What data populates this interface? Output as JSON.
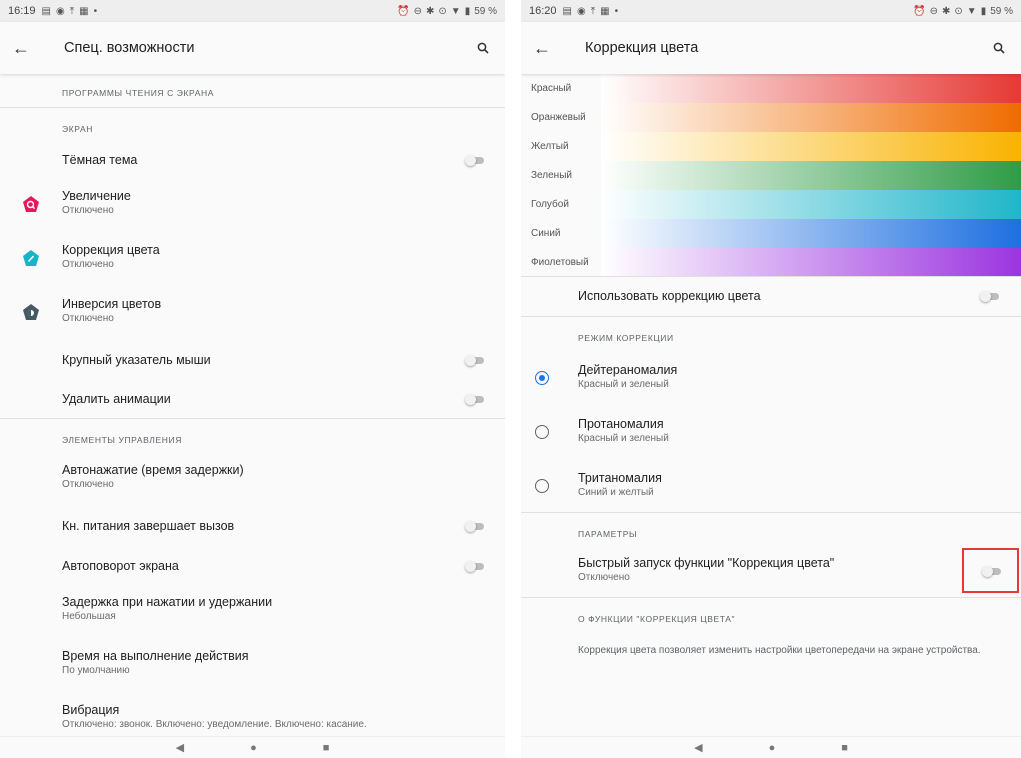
{
  "left": {
    "status": {
      "time": "16:19",
      "battery": "59 %"
    },
    "toolbar": {
      "title": "Спец. возможности"
    },
    "sections": {
      "screen_readers": "ПРОГРАММЫ ЧТЕНИЯ С ЭКРАНА",
      "screen": "ЭКРАН",
      "controls": "ЭЛЕМЕНТЫ УПРАВЛЕНИЯ"
    },
    "items": {
      "dark_theme": {
        "title": "Тёмная тема"
      },
      "magnification": {
        "title": "Увеличение",
        "sub": "Отключено"
      },
      "color_correction": {
        "title": "Коррекция цвета",
        "sub": "Отключено"
      },
      "color_inversion": {
        "title": "Инверсия цветов",
        "sub": "Отключено"
      },
      "large_pointer": {
        "title": "Крупный указатель мыши"
      },
      "remove_animations": {
        "title": "Удалить анимации"
      },
      "autoclick": {
        "title": "Автонажатие (время задержки)",
        "sub": "Отключено"
      },
      "power_ends_call": {
        "title": "Кн. питания завершает вызов"
      },
      "autorotate": {
        "title": "Автоповорот экрана"
      },
      "touch_hold_delay": {
        "title": "Задержка при нажатии и удержании",
        "sub": "Небольшая"
      },
      "action_time": {
        "title": "Время на выполнение действия",
        "sub": "По умолчанию"
      },
      "vibration": {
        "title": "Вибрация",
        "sub": "Отключено: звонок. Включено: уведомление. Включено: касание."
      }
    }
  },
  "right": {
    "status": {
      "time": "16:20",
      "battery": "59 %"
    },
    "toolbar": {
      "title": "Коррекция цвета"
    },
    "colors": [
      {
        "label": "Красный",
        "color": "#e53935"
      },
      {
        "label": "Оранжевый",
        "color": "#ef6c00"
      },
      {
        "label": "Желтый",
        "color": "#f9b300"
      },
      {
        "label": "Зеленый",
        "color": "#2e9c46"
      },
      {
        "label": "Голубой",
        "color": "#1fb6c9"
      },
      {
        "label": "Синий",
        "color": "#1e6fe0"
      },
      {
        "label": "Фиолетовый",
        "color": "#9b35e0"
      }
    ],
    "use_correction": {
      "title": "Использовать коррекцию цвета"
    },
    "mode_header": "РЕЖИМ КОРРЕКЦИИ",
    "modes": [
      {
        "title": "Дейтераномалия",
        "sub": "Красный и зеленый",
        "selected": true
      },
      {
        "title": "Протаномалия",
        "sub": "Красный и зеленый",
        "selected": false
      },
      {
        "title": "Тританомалия",
        "sub": "Синий и желтый",
        "selected": false
      }
    ],
    "params_header": "ПАРАМЕТРЫ",
    "shortcut": {
      "title": "Быстрый запуск функции \"Коррекция цвета\"",
      "sub": "Отключено"
    },
    "about_header": "О ФУНКЦИИ \"КОРРЕКЦИЯ ЦВЕТА\"",
    "about_text": "Коррекция цвета позволяет изменить настройки цветопередачи на экране устройства."
  },
  "colors": {
    "accent": "#1a73e8",
    "highlight": "#e53935"
  }
}
